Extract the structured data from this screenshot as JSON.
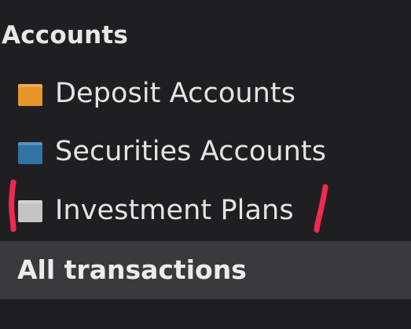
{
  "accounts": {
    "title": "Accounts",
    "items": [
      {
        "label": "Deposit Accounts",
        "color": "#e8952c",
        "icon": "folder-icon"
      },
      {
        "label": "Securities Accounts",
        "color": "#2f74a3",
        "icon": "folder-icon"
      },
      {
        "label": "Investment Plans",
        "color": "#c4c4c4",
        "icon": "folder-icon"
      }
    ]
  },
  "all_transactions": {
    "label": "All transactions"
  },
  "theme": {
    "background": "#1f1f21",
    "selected_row": "#3a3a3d",
    "annotation_marks": "#f2294f"
  }
}
